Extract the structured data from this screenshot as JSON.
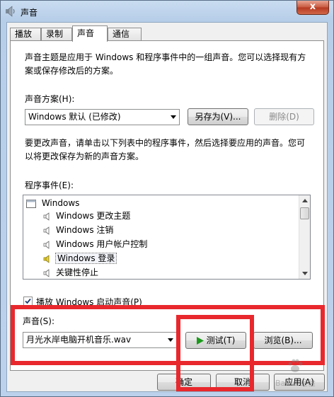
{
  "window": {
    "title": "声音",
    "close_label": "x"
  },
  "tabs": [
    {
      "label": "播放",
      "active": false
    },
    {
      "label": "录制",
      "active": false
    },
    {
      "label": "声音",
      "active": true
    },
    {
      "label": "通信",
      "active": false
    }
  ],
  "intro": {
    "line1": "声音主题是应用于 Windows 和程序事件中的一组声音。您可以选择现有方",
    "line2": "案或保存修改后的方案。"
  },
  "scheme": {
    "label": "声音方案(H):",
    "selected": "Windows 默认 (已修改)",
    "save_as_label": "另存为(V)...",
    "delete_label": "删除(D)"
  },
  "change_hint": {
    "line1": "要更改声音，请单击以下列表中的程序事件，然后选择要应用的声音。您可",
    "line2": "以将更改保存为新的声音方案。"
  },
  "events": {
    "label": "程序事件(E):",
    "root": "Windows",
    "items": [
      {
        "label": "Windows 更改主题",
        "selected": false
      },
      {
        "label": "Windows 注销",
        "selected": false
      },
      {
        "label": "Windows 用户帐户控制",
        "selected": false
      },
      {
        "label": "Windows 登录",
        "selected": true
      },
      {
        "label": "关键性停止",
        "selected": false
      }
    ]
  },
  "startup": {
    "label": "播放 Windows 启动声音(P)",
    "checked": true
  },
  "sound": {
    "label": "声音(S):",
    "selected": "月光水岸电脑开机音乐.wav",
    "test_label": "测试(T)",
    "browse_label": "浏览(B)..."
  },
  "footer": {
    "ok_label": "确定",
    "cancel_label": "取消",
    "apply_label": "应用(A)"
  },
  "watermark": {
    "text": "Baidu 经验"
  },
  "colors": {
    "highlight": "#e8282d",
    "play_icon": "#1a9a1a",
    "speaker_selected": "#e6d23a"
  }
}
